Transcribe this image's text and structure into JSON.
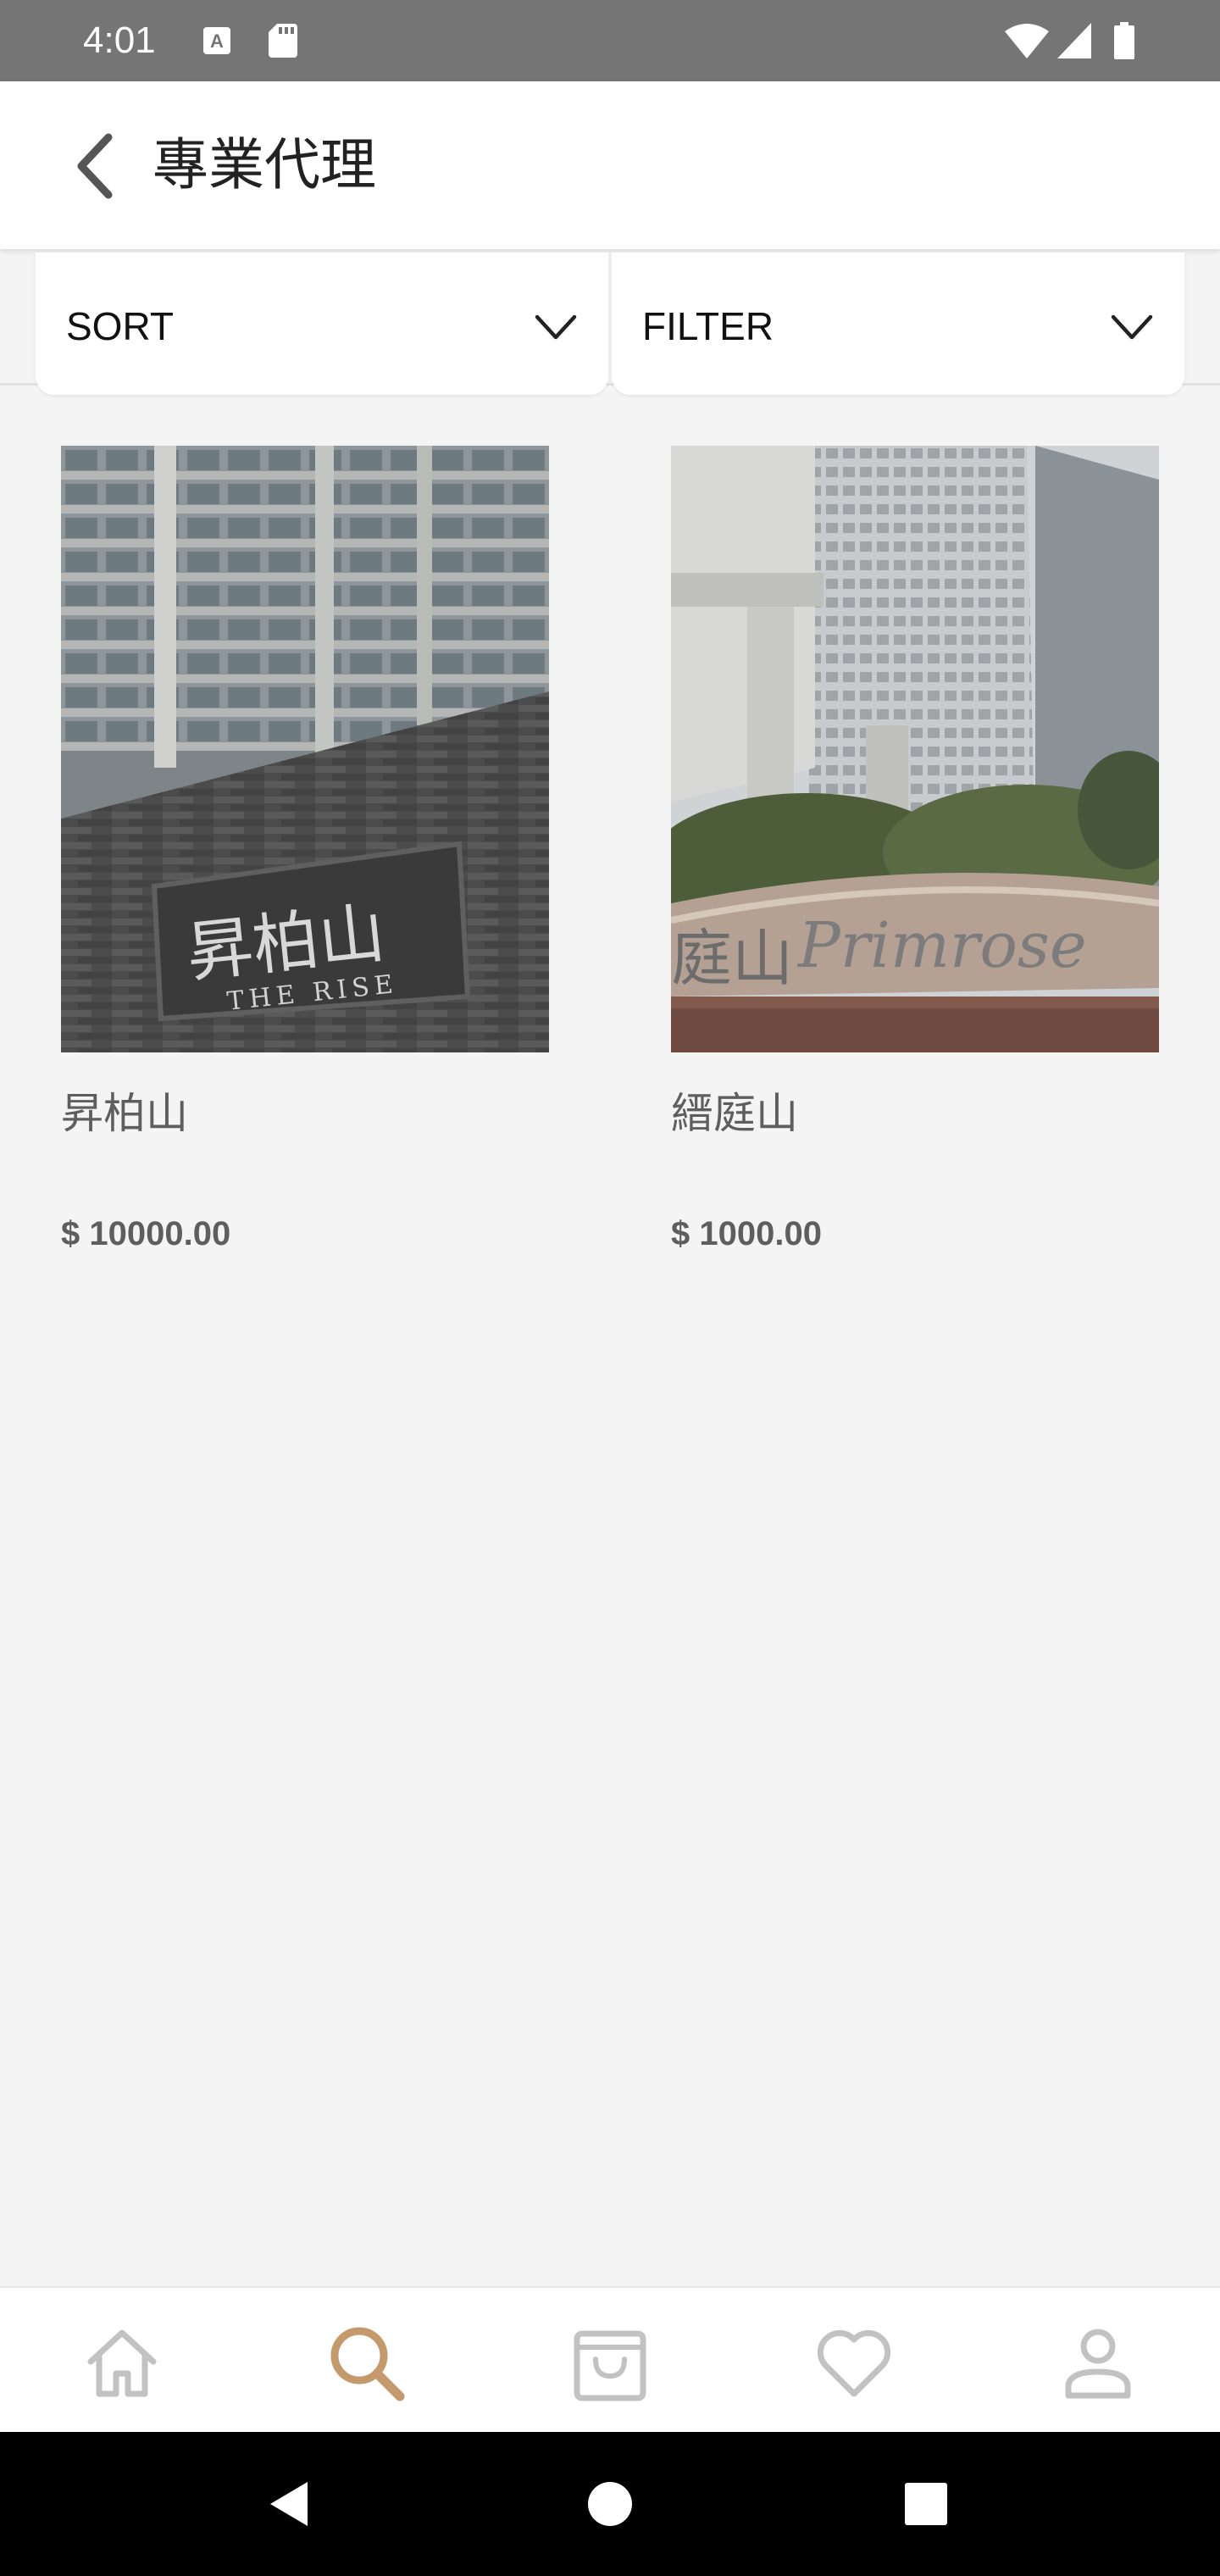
{
  "status_bar": {
    "time": "4:01",
    "icons": [
      "keyboard-a-icon",
      "sd-card-icon",
      "wifi-icon",
      "signal-icon",
      "battery-icon"
    ]
  },
  "app_bar": {
    "title": "專業代理",
    "back_icon": "back-chevron-icon"
  },
  "controls": {
    "sort_label": "SORT",
    "filter_label": "FILTER"
  },
  "products": [
    {
      "name": "昇柏山",
      "price": "$ 10000.00",
      "image_sign": "昇柏山",
      "image_sign_en": "THE RISE"
    },
    {
      "name": "縉庭山",
      "price": "$ 1000.00",
      "image_sign": "庭山",
      "image_sign_en": "Primrose"
    }
  ],
  "bottom_nav": {
    "items": [
      "home-icon",
      "search-icon",
      "shopping-bag-icon",
      "heart-icon",
      "profile-icon"
    ],
    "active": "search-icon"
  },
  "colors": {
    "accent": "#c49a6c",
    "inactive_icon": "#c2c2c2",
    "status_bar": "#757575",
    "page_background": "#f4f4f4"
  }
}
